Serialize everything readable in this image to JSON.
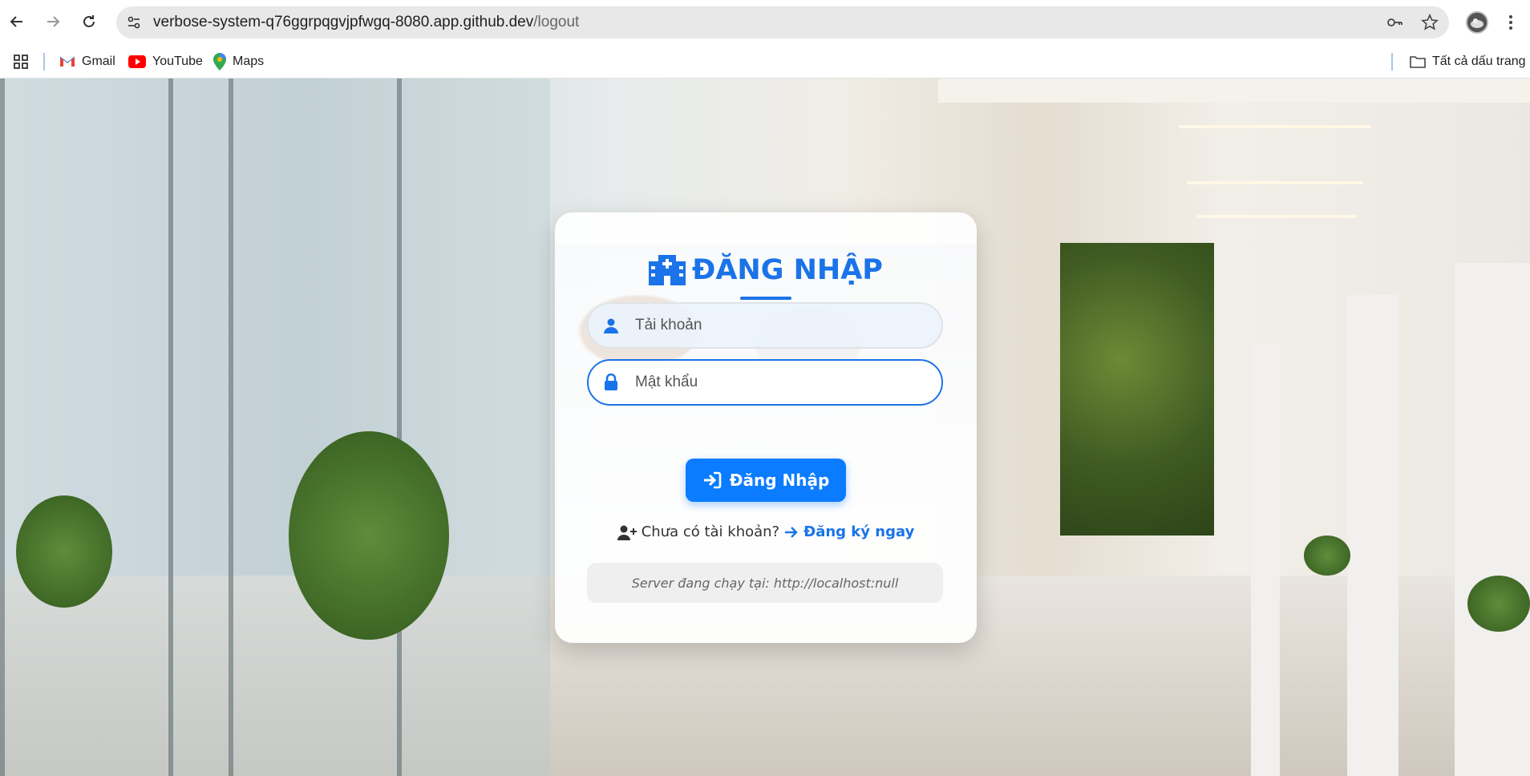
{
  "browser": {
    "url_host": "verbose-system-q76ggrpqgvjpfwgq-8080.app.github.dev",
    "url_path": "/logout",
    "bookmarks": [
      {
        "label": "Gmail",
        "icon": "gmail-icon"
      },
      {
        "label": "YouTube",
        "icon": "youtube-icon"
      },
      {
        "label": "Maps",
        "icon": "maps-icon"
      }
    ],
    "all_bookmarks_label": "Tất cả dấu trang"
  },
  "login": {
    "title": "ĐĂNG NHẬP",
    "username_placeholder": "Tải khoản",
    "password_placeholder": "Mật khẩu",
    "submit_label": "Đăng Nhập",
    "no_account_text": "Chưa có tài khoản?",
    "register_link": "Đăng ký ngay",
    "server_text": "Server đang chạy tại: http://localhost:null"
  },
  "colors": {
    "accent": "#1a73e8",
    "button": "#0b7cff"
  }
}
